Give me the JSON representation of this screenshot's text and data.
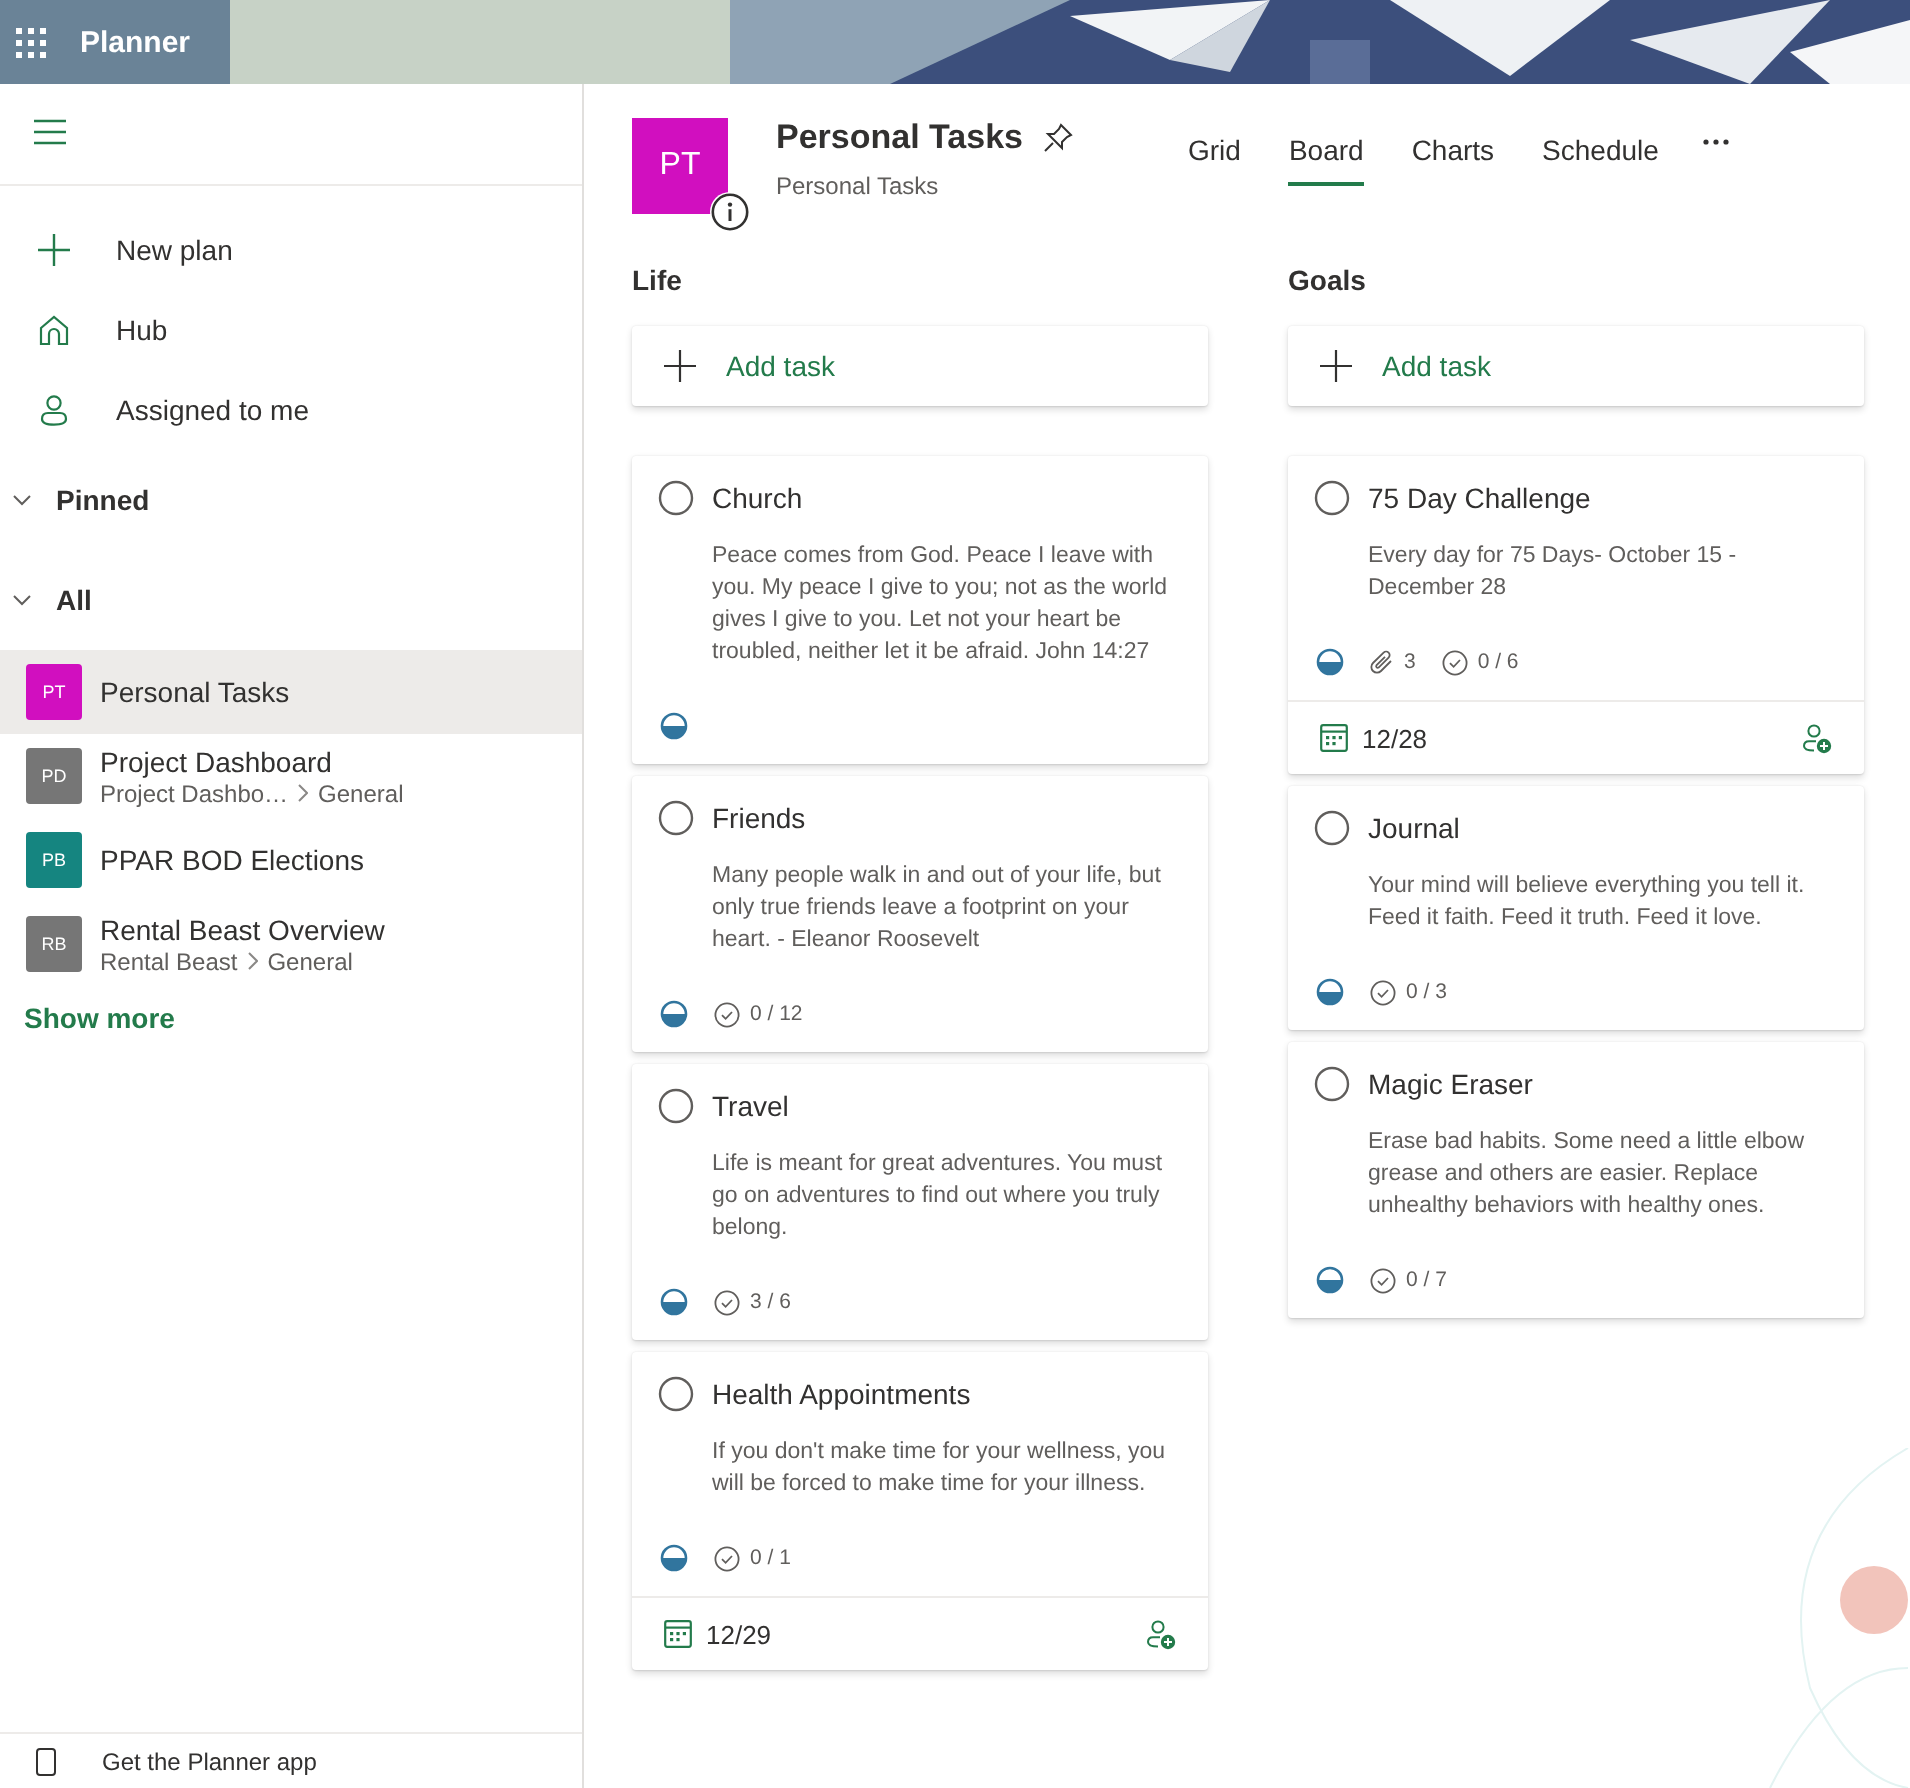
{
  "app": {
    "title": "Planner"
  },
  "sidebar": {
    "nav": [
      {
        "kind": "new",
        "label": "New plan"
      },
      {
        "kind": "hub",
        "label": "Hub"
      },
      {
        "kind": "assigned",
        "label": "Assigned to me"
      }
    ],
    "sections": [
      {
        "label": "Pinned",
        "expanded": true
      },
      {
        "label": "All",
        "expanded": true,
        "plans": [
          {
            "initials": "PT",
            "name": "Personal Tasks",
            "color": "#d10fbf",
            "selected": true
          },
          {
            "initials": "PD",
            "name": "Project Dashboard",
            "group": "Project Dashbo…",
            "channel": "General",
            "color": "#767676",
            "selected": false
          },
          {
            "initials": "PB",
            "name": "PPAR BOD Elections",
            "color": "#158580",
            "selected": false
          },
          {
            "initials": "RB",
            "name": "Rental Beast Overview",
            "group": "Rental Beast",
            "channel": "General",
            "color": "#767676",
            "selected": false
          }
        ]
      }
    ],
    "show_more": "Show more",
    "footer": "Get the Planner app"
  },
  "plan": {
    "initials": "PT",
    "color": "#d10fbf",
    "title": "Personal Tasks",
    "subtitle": "Personal Tasks",
    "tabs": [
      {
        "label": "Grid",
        "selected": false
      },
      {
        "label": "Board",
        "selected": true
      },
      {
        "label": "Charts",
        "selected": false
      },
      {
        "label": "Schedule",
        "selected": false
      }
    ]
  },
  "buckets": [
    {
      "name": "Life",
      "add_label": "Add task",
      "tasks": [
        {
          "title": "Church",
          "completed": false,
          "notes": "Peace comes from God. Peace I leave with you. My peace I give to you; not as the world gives I give to you. Let not your heart be troubled, neither let it be afraid. John 14:27",
          "in_progress": true
        },
        {
          "title": "Friends",
          "completed": false,
          "notes": "Many people walk in and out of your life, but only true friends leave a footprint on your heart. - Eleanor Roosevelt",
          "in_progress": true,
          "checklist": "0 / 12"
        },
        {
          "title": "Travel",
          "completed": false,
          "notes": "Life is meant for great adventures. You must go on adventures to find out where you truly belong.",
          "in_progress": true,
          "checklist": "3 / 6"
        },
        {
          "title": "Health Appointments",
          "completed": false,
          "notes": "If you don't make time for your wellness, you will be forced to make time for your illness.",
          "in_progress": true,
          "checklist": "0 / 1",
          "due": "12/29"
        }
      ]
    },
    {
      "name": "Goals",
      "add_label": "Add task",
      "tasks": [
        {
          "title": "75 Day Challenge",
          "completed": false,
          "notes": "Every day for 75 Days- October 15 - December 28",
          "in_progress": true,
          "attachments": "3",
          "checklist": "0 / 6",
          "due": "12/28"
        },
        {
          "title": "Journal",
          "completed": false,
          "notes": "Your mind will believe everything you tell it. Feed it faith. Feed it truth. Feed it love.",
          "in_progress": true,
          "checklist": "0 / 3"
        },
        {
          "title": "Magic Eraser",
          "completed": false,
          "notes": "Erase bad habits. Some need a little elbow grease and others are easier. Replace unhealthy behaviors with healthy ones.",
          "in_progress": true,
          "checklist": "0 / 7"
        }
      ]
    }
  ]
}
